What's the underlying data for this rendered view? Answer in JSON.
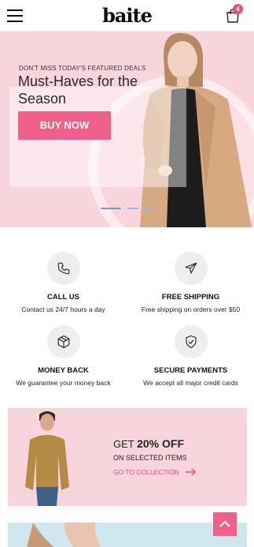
{
  "header": {
    "menu_icon": "hamburger-menu-icon",
    "logo": "baite",
    "cart_icon": "shopping-bag-icon",
    "cart_count": "4"
  },
  "hero": {
    "eyebrow": "DON'T MISS TODAY'S FEATURED DEALS",
    "title": "Must-Haves for the Season",
    "button_label": "BUY NOW",
    "slides_active_index": 0,
    "slides_count": 3
  },
  "features": [
    {
      "icon": "phone-icon",
      "title": "CALL US",
      "desc": "Contact us 24/7 hours a day"
    },
    {
      "icon": "airplane-icon",
      "title": "FREE SHIPPING",
      "desc": "Free shipping on orders over $50"
    },
    {
      "icon": "box-icon",
      "title": "MONEY BACK",
      "desc": "We guarantee your money back"
    },
    {
      "icon": "shield-check-icon",
      "title": "SECURE PAYMENTS",
      "desc": "We accept all major credit cards"
    }
  ],
  "promo": {
    "get_prefix": "GET ",
    "get_highlight": "20% OFF",
    "subtitle": "ON SELECTED ITEMS",
    "link_label": "GO TO COLLECTION",
    "link_icon": "arrow-right-icon"
  },
  "scroll_top": {
    "icon": "chevron-up-icon"
  },
  "colors": {
    "accent": "#f0608a",
    "hero_bg": "#f8d4dc",
    "banner2_bg": "#cfe8ef"
  }
}
